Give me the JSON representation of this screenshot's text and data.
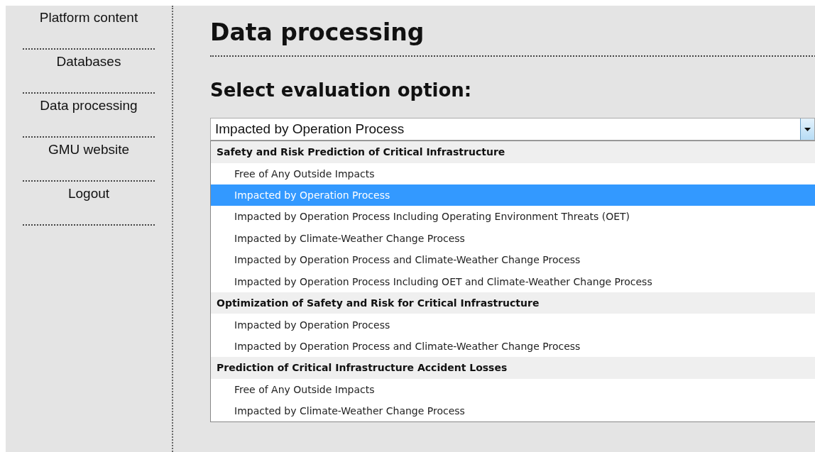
{
  "sidebar": {
    "items": [
      {
        "label": "Platform content"
      },
      {
        "label": "Databases"
      },
      {
        "label": "Data processing"
      },
      {
        "label": "GMU website"
      },
      {
        "label": "Logout"
      }
    ]
  },
  "title": "Data processing",
  "heading": "Select evaluation option:",
  "select": {
    "value": "Impacted by Operation Process",
    "expanded": true,
    "groups": [
      {
        "label": "Safety and Risk Prediction of Critical Infrastructure",
        "options": [
          {
            "label": "Free of Any Outside Impacts",
            "selected": false
          },
          {
            "label": "Impacted by Operation Process",
            "selected": true
          },
          {
            "label": "Impacted by Operation Process Including Operating Environment Threats (OET)",
            "selected": false
          },
          {
            "label": "Impacted by Climate-Weather Change Process",
            "selected": false
          },
          {
            "label": "Impacted by Operation Process and Climate-Weather Change Process",
            "selected": false
          },
          {
            "label": "Impacted by Operation Process Including OET and Climate-Weather Change Process",
            "selected": false
          }
        ]
      },
      {
        "label": "Optimization of Safety and Risk for Critical Infrastructure",
        "options": [
          {
            "label": "Impacted by Operation Process",
            "selected": false
          },
          {
            "label": "Impacted by Operation Process and Climate-Weather Change Process",
            "selected": false
          }
        ]
      },
      {
        "label": "Prediction of Critical Infrastructure Accident Losses",
        "options": [
          {
            "label": "Free of Any Outside Impacts",
            "selected": false
          },
          {
            "label": "Impacted by Climate-Weather Change Process",
            "selected": false
          }
        ]
      }
    ]
  }
}
